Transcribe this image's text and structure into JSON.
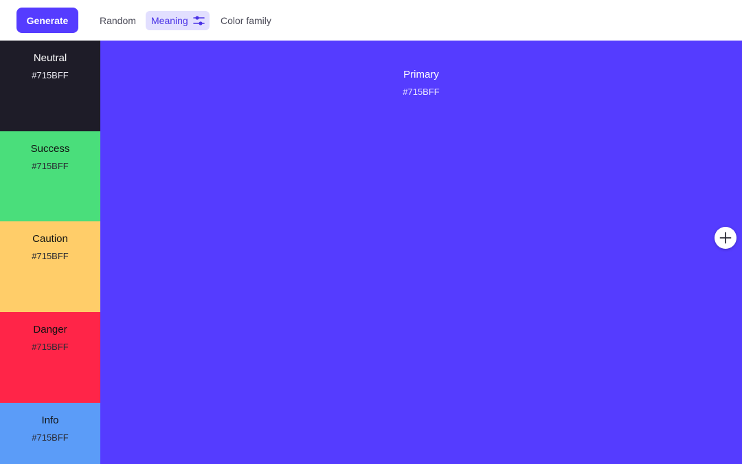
{
  "toolbar": {
    "generate_label": "Generate",
    "tabs": [
      {
        "label": "Random",
        "active": false
      },
      {
        "label": "Meaning",
        "active": true,
        "icon": "sliders-icon"
      },
      {
        "label": "Color family",
        "active": false
      }
    ]
  },
  "palette": {
    "sidebar": [
      {
        "name": "Neutral",
        "hex": "#715BFF",
        "color": "#1E1C28"
      },
      {
        "name": "Success",
        "hex": "#715BFF",
        "color": "#4ADE7B"
      },
      {
        "name": "Caution",
        "hex": "#715BFF",
        "color": "#FFCD69"
      },
      {
        "name": "Danger",
        "hex": "#715BFF",
        "color": "#FF2548"
      },
      {
        "name": "Info",
        "hex": "#715BFF",
        "color": "#5B9CF8"
      }
    ],
    "primary": {
      "name": "Primary",
      "hex": "#715BFF",
      "color": "#553CFF"
    }
  },
  "add_button": {
    "icon": "plus-icon"
  },
  "colors": {
    "accent": "#553CFF",
    "active_tab_bg": "#E2DFFF"
  }
}
